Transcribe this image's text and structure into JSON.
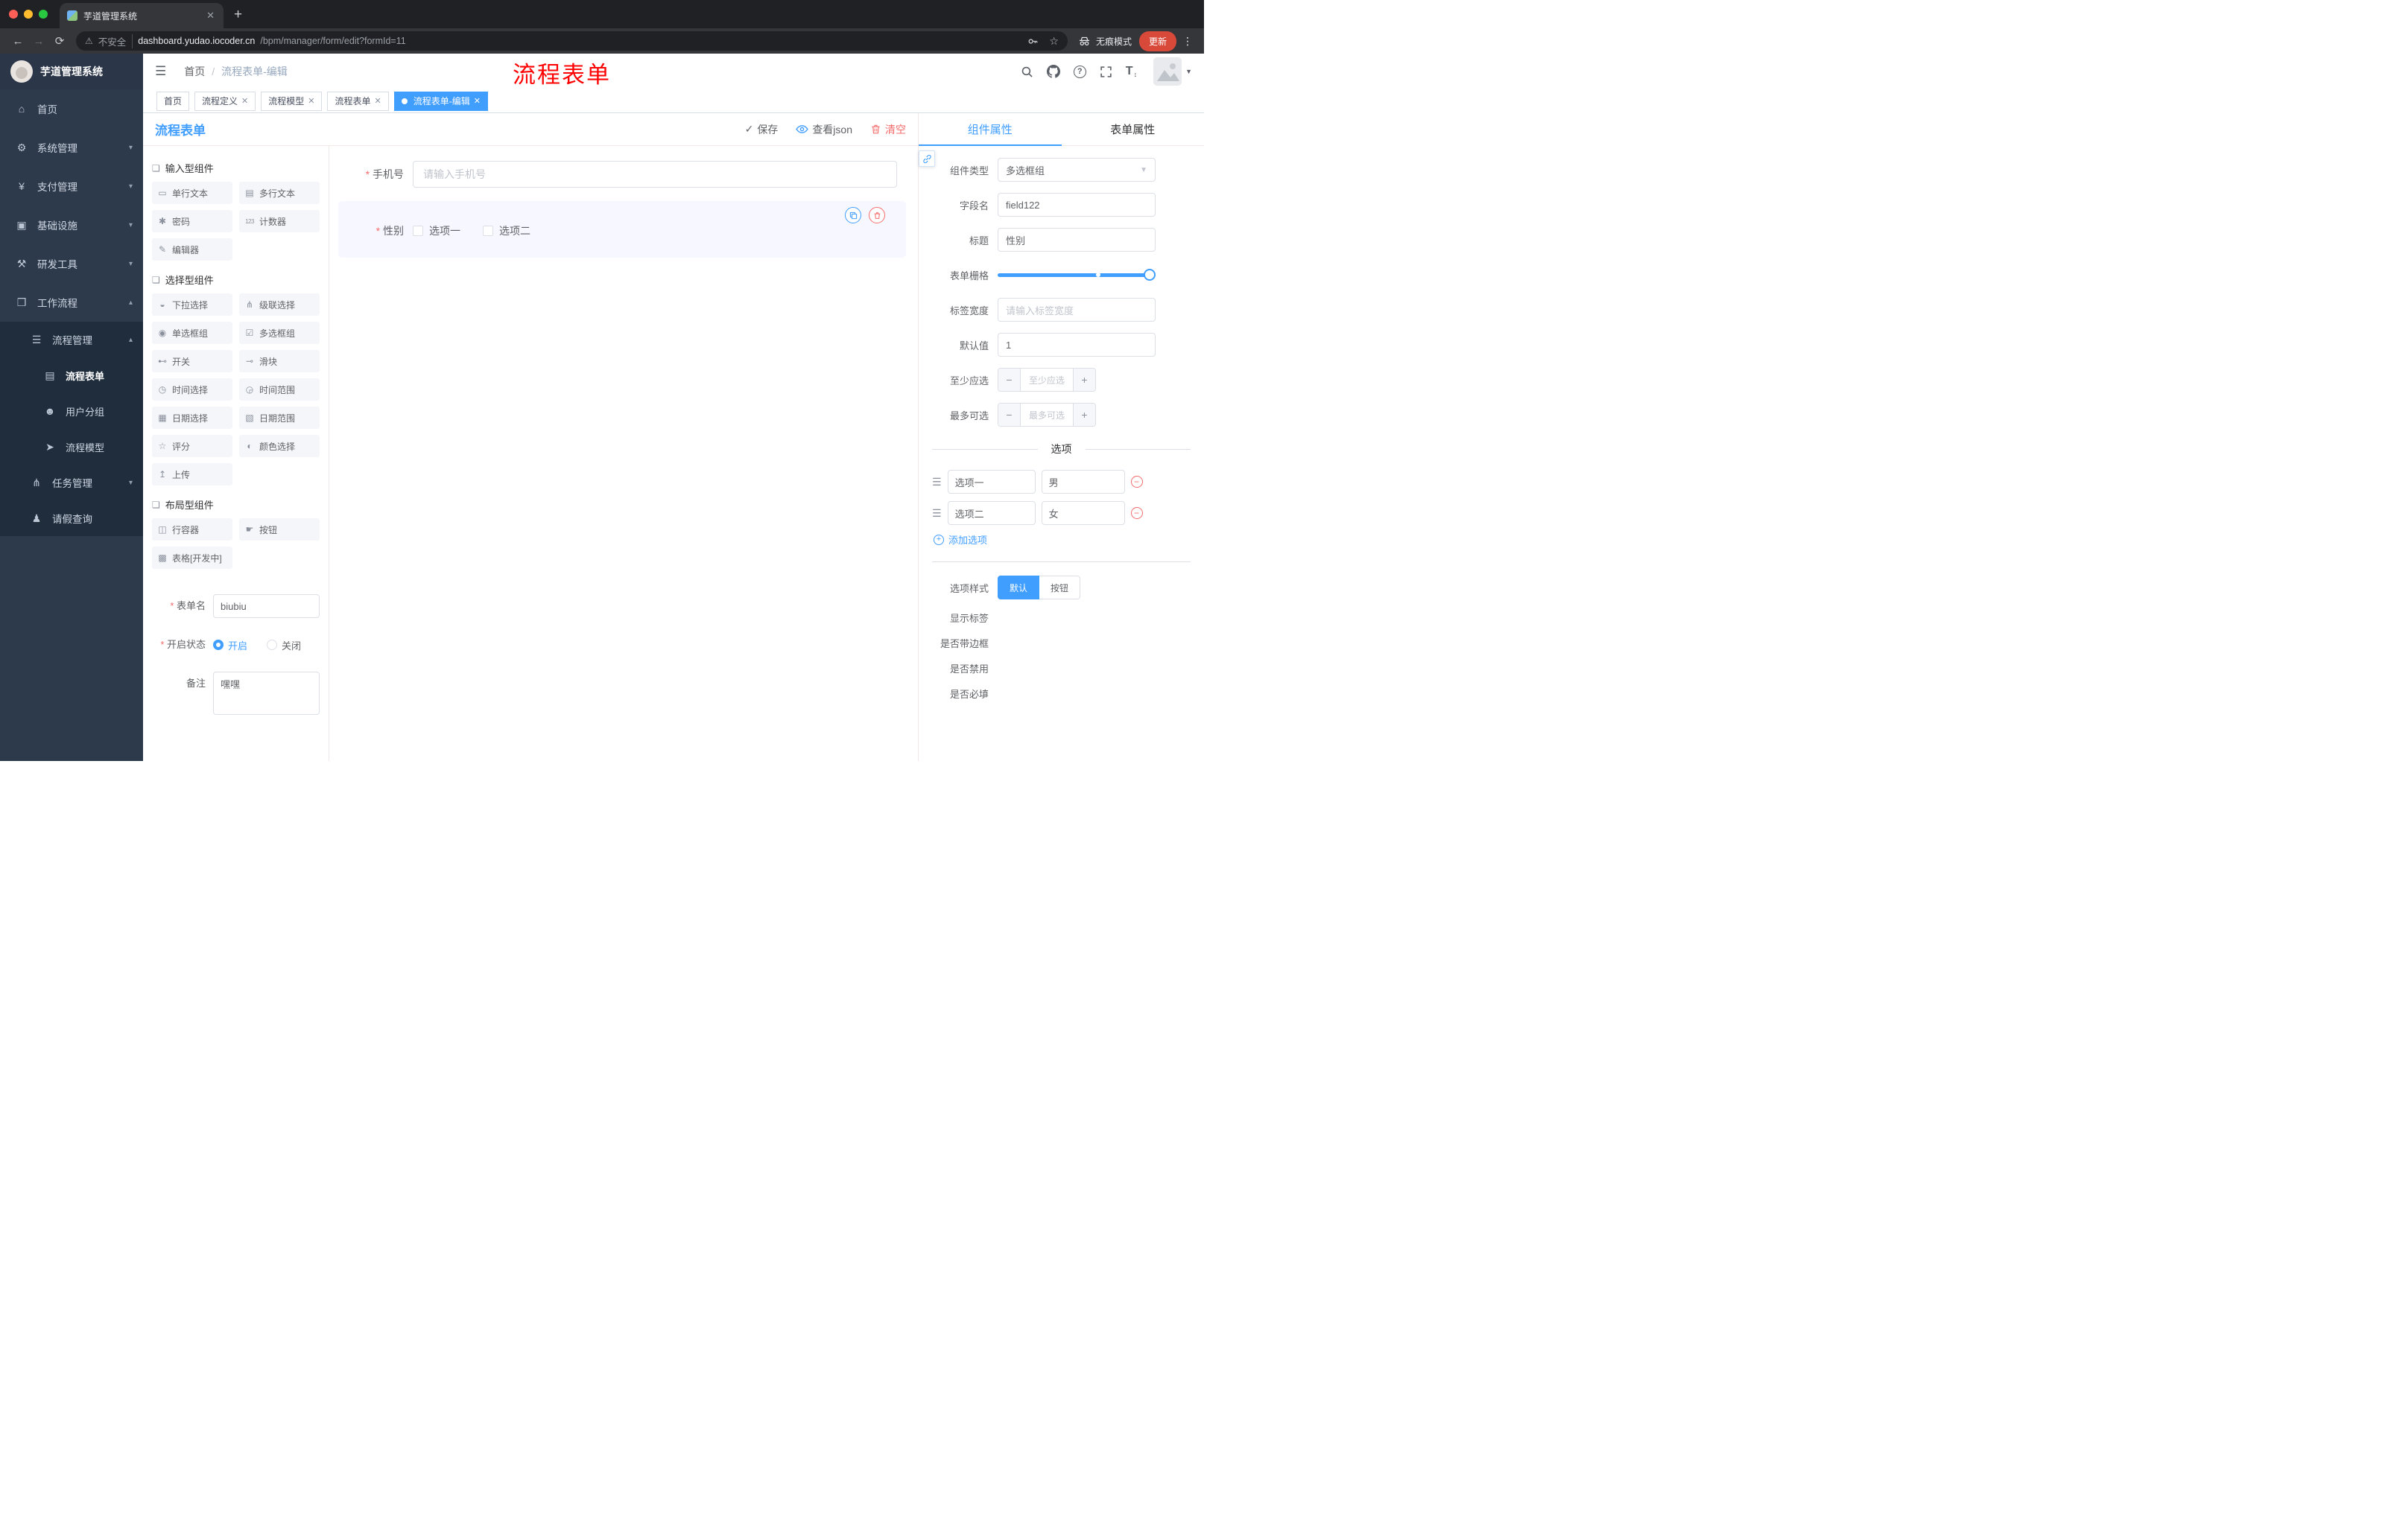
{
  "browser": {
    "tab_title": "芋道管理系统",
    "security_label": "不安全",
    "url_host": "dashboard.yudao.iocoder.cn",
    "url_path": "/bpm/manager/form/edit?formId=11",
    "incognito_label": "无痕模式",
    "update_label": "更新"
  },
  "sidebar": {
    "logo_title": "芋道管理系统",
    "items": [
      {
        "label": "首页",
        "icon": "home-icon"
      },
      {
        "label": "系统管理",
        "icon": "gear-icon"
      },
      {
        "label": "支付管理",
        "icon": "yen-icon"
      },
      {
        "label": "基础设施",
        "icon": "infrastructure-icon"
      },
      {
        "label": "研发工具",
        "icon": "dev-tools-icon"
      },
      {
        "label": "工作流程",
        "icon": "workflow-icon"
      },
      {
        "label": "流程管理",
        "icon": "process-management-icon"
      },
      {
        "label": "流程表单",
        "icon": "process-form-icon",
        "active": true
      },
      {
        "label": "用户分组",
        "icon": "user-group-icon"
      },
      {
        "label": "流程模型",
        "icon": "process-model-icon"
      },
      {
        "label": "任务管理",
        "icon": "task-management-icon"
      },
      {
        "label": "请假查询",
        "icon": "leave-query-icon"
      }
    ]
  },
  "header": {
    "breadcrumb_root": "首页",
    "breadcrumb_current": "流程表单-编辑",
    "annotation": "流程表单"
  },
  "tags": [
    {
      "label": "首页",
      "closable": false,
      "active": false
    },
    {
      "label": "流程定义",
      "closable": true,
      "active": false
    },
    {
      "label": "流程模型",
      "closable": true,
      "active": false
    },
    {
      "label": "流程表单",
      "closable": true,
      "active": false
    },
    {
      "label": "流程表单-编辑",
      "closable": true,
      "active": true
    }
  ],
  "editor": {
    "title": "流程表单",
    "toolbar": {
      "save": "保存",
      "view_json": "查看json",
      "clear": "清空"
    }
  },
  "palette": {
    "groups": [
      {
        "label": "输入型组件",
        "items": [
          {
            "label": "单行文本",
            "icon": "single-line-text-icon"
          },
          {
            "label": "多行文本",
            "icon": "multi-line-text-icon"
          },
          {
            "label": "密码",
            "icon": "password-icon"
          },
          {
            "label": "计数器",
            "icon": "counter-icon"
          },
          {
            "label": "编辑器",
            "icon": "editor-icon"
          }
        ]
      },
      {
        "label": "选择型组件",
        "items": [
          {
            "label": "下拉选择",
            "icon": "select-icon"
          },
          {
            "label": "级联选择",
            "icon": "cascader-icon"
          },
          {
            "label": "单选框组",
            "icon": "radio-group-icon"
          },
          {
            "label": "多选框组",
            "icon": "checkbox-group-icon"
          },
          {
            "label": "开关",
            "icon": "switch-icon"
          },
          {
            "label": "滑块",
            "icon": "slider-icon"
          },
          {
            "label": "时间选择",
            "icon": "time-picker-icon"
          },
          {
            "label": "时间范围",
            "icon": "time-range-icon"
          },
          {
            "label": "日期选择",
            "icon": "date-picker-icon"
          },
          {
            "label": "日期范围",
            "icon": "date-range-icon"
          },
          {
            "label": "评分",
            "icon": "rate-icon"
          },
          {
            "label": "颜色选择",
            "icon": "color-picker-icon"
          },
          {
            "label": "上传",
            "icon": "upload-icon"
          }
        ]
      },
      {
        "label": "布局型组件",
        "items": [
          {
            "label": "行容器",
            "icon": "row-container-icon"
          },
          {
            "label": "按钮",
            "icon": "button-icon"
          },
          {
            "label": "表格[开发中]",
            "icon": "table-icon"
          }
        ]
      }
    ],
    "form": {
      "name_label": "表单名",
      "name_value": "biubiu",
      "status_label": "开启状态",
      "status_on": "开启",
      "status_off": "关闭",
      "remark_label": "备注",
      "remark_value": "嘿嘿"
    }
  },
  "canvas": {
    "phone_label": "手机号",
    "phone_placeholder": "请输入手机号",
    "gender_label": "性别",
    "gender_options": [
      "选项一",
      "选项二"
    ]
  },
  "inspector": {
    "tab_component": "组件属性",
    "tab_form": "表单属性",
    "component_type_label": "组件类型",
    "component_type_value": "多选框组",
    "field_name_label": "字段名",
    "field_name_value": "field122",
    "title_label": "标题",
    "title_value": "性别",
    "grid_label": "表单栅格",
    "label_width_label": "标签宽度",
    "label_width_placeholder": "请输入标签宽度",
    "default_label": "默认值",
    "default_value": "1",
    "min_label": "至少应选",
    "min_placeholder": "至少应选",
    "max_label": "最多可选",
    "max_placeholder": "最多可选",
    "options_title": "选项",
    "options": [
      {
        "label": "选项一",
        "value": "男"
      },
      {
        "label": "选项二",
        "value": "女"
      }
    ],
    "add_option_label": "添加选项",
    "option_style_label": "选项样式",
    "option_style_default": "默认",
    "option_style_button": "按钮",
    "switch_show_label": "显示标签",
    "switch_border": "是否带边框",
    "switch_disabled": "是否禁用",
    "switch_required": "是否必填",
    "accent_color": "#409eff",
    "danger_color": "#f56c6c"
  }
}
